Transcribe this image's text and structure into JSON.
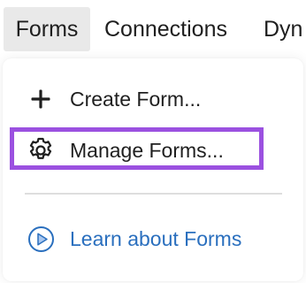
{
  "menubar": {
    "tabs": [
      {
        "label": "Forms",
        "active": true
      },
      {
        "label": "Connections",
        "active": false
      },
      {
        "label": "Dyn",
        "active": false
      }
    ]
  },
  "dropdown": {
    "items": [
      {
        "label": "Create Form...",
        "icon": "plus-icon"
      },
      {
        "label": "Manage Forms...",
        "icon": "gear-icon",
        "highlighted": true
      },
      {
        "label": "Learn about Forms",
        "icon": "play-circle-icon"
      }
    ]
  },
  "colors": {
    "highlight": "#9b51e0",
    "link": "#2a6fbe",
    "active_tab_bg": "#e9e9e9"
  }
}
